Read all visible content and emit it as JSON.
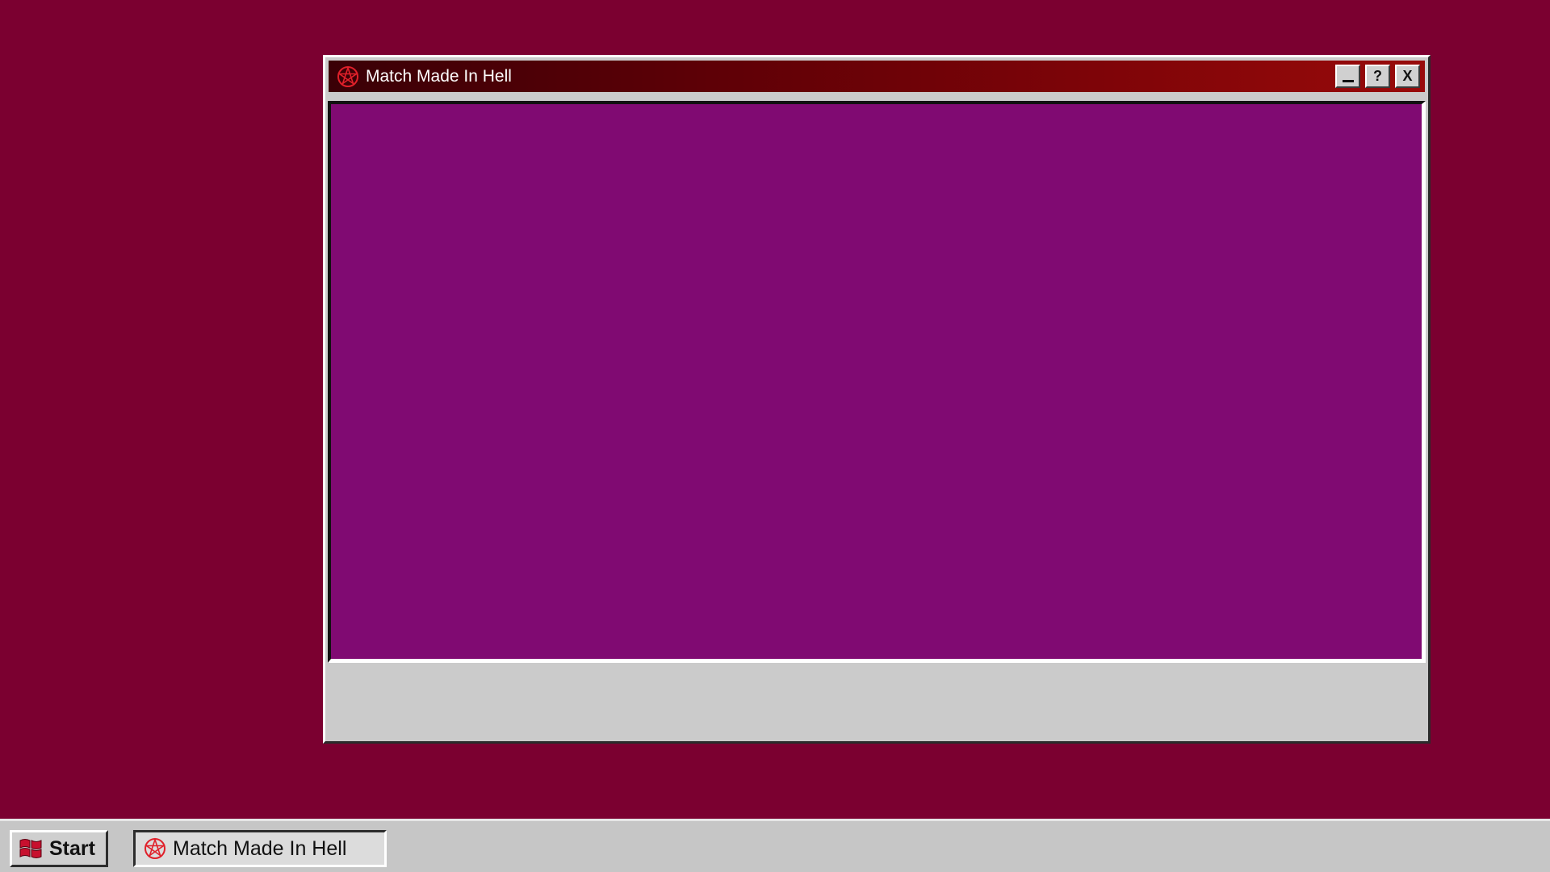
{
  "window": {
    "title": "Match Made In Hell",
    "icon": "pentagram-icon",
    "buttons": {
      "minimize": "_",
      "help": "?",
      "close": "X"
    },
    "content_color": "#800a72"
  },
  "taskbar": {
    "start_label": "Start",
    "start_icon": "flag-icon",
    "items": [
      {
        "label": "Match Made In Hell",
        "icon": "pentagram-icon"
      }
    ]
  },
  "colors": {
    "desktop": "#7b0030",
    "titlebar_start": "#3a0006",
    "titlebar_end": "#980a0a",
    "window_face": "#cbcbcb",
    "taskbar": "#c6c6c6"
  }
}
